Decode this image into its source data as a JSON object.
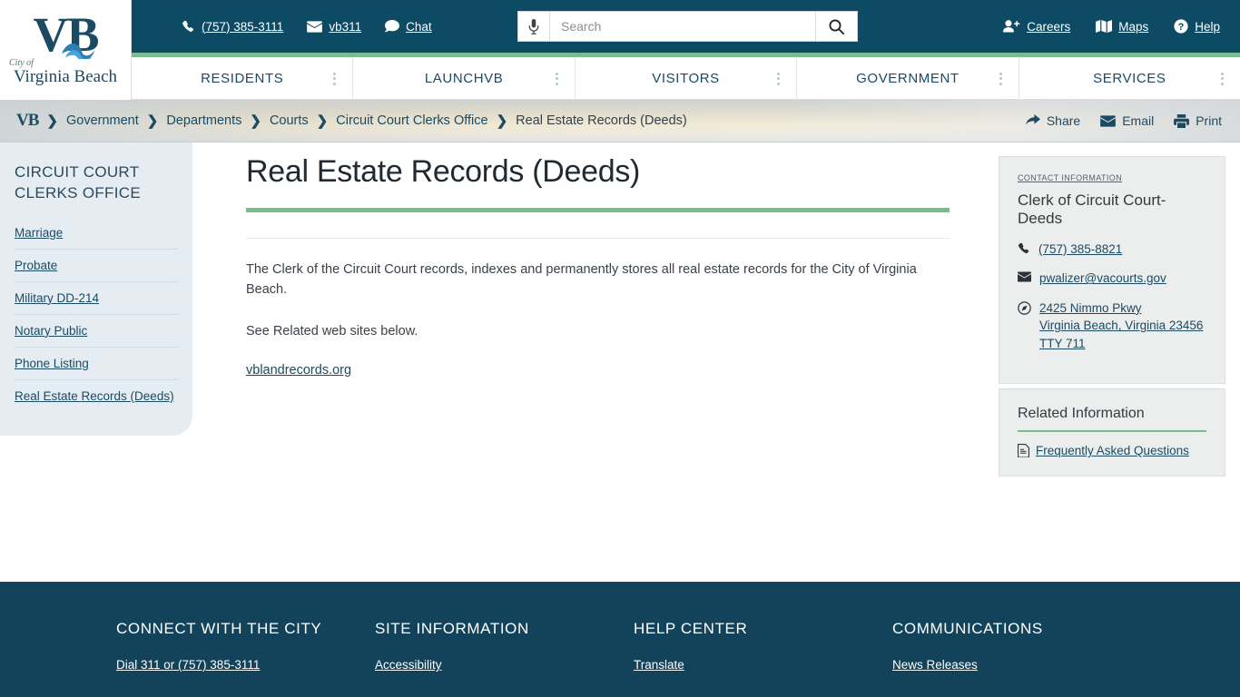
{
  "logo": {
    "mark": "VB",
    "cityof": "City of",
    "name": "Virginia Beach"
  },
  "topbar": {
    "links": [
      {
        "label": "(757) 385-3111",
        "icon": "phone-icon"
      },
      {
        "label": "vb311",
        "icon": "envelope-icon"
      },
      {
        "label": "Chat",
        "icon": "chat-bubble-icon"
      }
    ],
    "right_links": [
      {
        "label": "Careers",
        "icon": "user-plus-icon"
      },
      {
        "label": "Maps",
        "icon": "map-icon"
      },
      {
        "label": "Help",
        "icon": "question-circle-icon"
      }
    ],
    "search": {
      "placeholder": "Search",
      "value": "",
      "mic_icon": "microphone-icon",
      "submit_icon": "search-icon"
    }
  },
  "mainnav": {
    "accent_color": "#79bd8f",
    "items": [
      {
        "label": "RESIDENTS"
      },
      {
        "label": "LAUNCHVB"
      },
      {
        "label": "VISITORS"
      },
      {
        "label": "GOVERNMENT"
      },
      {
        "label": "SERVICES"
      }
    ]
  },
  "breadcrumb": {
    "home_mark": "VB",
    "separator": "❯",
    "items": [
      "Government",
      "Departments",
      "Courts",
      "Circuit Court Clerks Office",
      "Real Estate Records (Deeds)"
    ],
    "actions": [
      {
        "label": "Share",
        "icon": "share-arrow-icon"
      },
      {
        "label": "Email",
        "icon": "envelope-icon"
      },
      {
        "label": "Print",
        "icon": "printer-icon"
      }
    ]
  },
  "sidebar": {
    "title": "Circuit Court Clerks Office",
    "items": [
      {
        "label": "Marriage"
      },
      {
        "label": "Probate"
      },
      {
        "label": "Military DD-214"
      },
      {
        "label": "Notary Public"
      },
      {
        "label": "Phone Listing"
      },
      {
        "label": "Real Estate Records (Deeds)"
      }
    ]
  },
  "main": {
    "title": "Real Estate Records (Deeds)",
    "paragraphs": [
      "The Clerk of the Circuit Court records, indexes and permanently stores all real estate records for the City of Virginia Beach.",
      "See Related web sites below."
    ],
    "link": "vblandrecords.org"
  },
  "contact_card": {
    "label": "CONTACT INFORMATION",
    "title": "Clerk of Circuit Court-Deeds",
    "phone": "(757) 385-8821",
    "email": "pwalizer@vacourts.gov",
    "address_line1": "2425 Nimmo Pkwy",
    "address_line2": "Virginia Beach, Virginia  23456 TTY 711"
  },
  "related_card": {
    "title": "Related Information",
    "links": [
      {
        "label": "Frequently Asked Questions",
        "icon": "pdf-file-icon"
      }
    ]
  },
  "footer": {
    "columns": [
      {
        "heading": "CONNECT WITH THE CITY",
        "links": [
          "Dial 311 or (757) 385-3111"
        ]
      },
      {
        "heading": "SITE INFORMATION",
        "links": [
          "Accessibility"
        ]
      },
      {
        "heading": "HELP CENTER",
        "links": [
          "Translate"
        ]
      },
      {
        "heading": "COMMUNICATIONS",
        "links": [
          "News Releases"
        ]
      }
    ]
  },
  "colors": {
    "header_navy": "#0d4a63",
    "footer_navy": "#12435a",
    "accent_green": "#79bd8f",
    "link_navy": "#1b4a63",
    "sidebar_bg": "#e6edf2",
    "card_bg": "#eceeed"
  }
}
